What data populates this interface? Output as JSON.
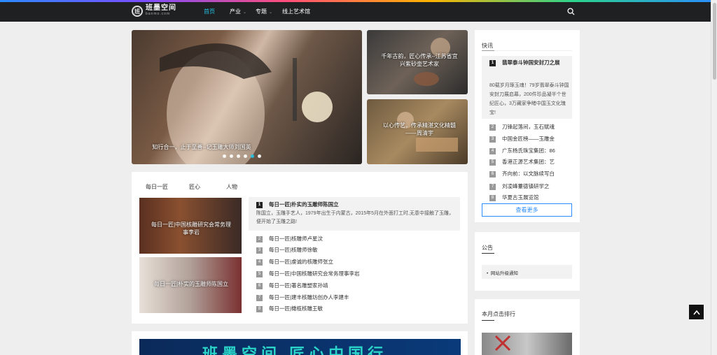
{
  "header": {
    "logo_mark": "班",
    "logo_title": "班墨空间",
    "logo_sub": "banmo.com",
    "nav": [
      "首页",
      "产业",
      "专题",
      "线上艺术馆"
    ]
  },
  "slider": {
    "main_caption": "知行合一，止于至善--记玉雕大师刘国英",
    "side_captions": [
      "千年古韵，匠心传承--江苏省宜兴紫砂壶艺术家",
      "以心传艺，传承精湛文化精髓——周清宇"
    ]
  },
  "feature": {
    "tabs": [
      "每日一匠",
      "匠心",
      "人物"
    ],
    "photo_captions": [
      "每日一匠|中国核雕研究会常务理事李岩",
      "每日一匠|朴实的玉雕师陈国立"
    ],
    "top_item": {
      "rank": "1",
      "title": "每日一匠|朴实的玉雕师陈国立",
      "desc": "陈国立，玉雕手艺人，1979年出生于内蒙古，2015年5月在外面打工时,无意中接触了玉雕，便开始了玉雕之路!"
    },
    "items": [
      {
        "rank": "2",
        "title": "每日一匠|核雕师卢星汶"
      },
      {
        "rank": "3",
        "title": "每日一匠|核雕师徐敏"
      },
      {
        "rank": "4",
        "title": "每日一匠|虔诚的核雕师张立"
      },
      {
        "rank": "5",
        "title": "每日一匠|中国核雕研究会常务理事李岩"
      },
      {
        "rank": "6",
        "title": "每日一匠|著名雕塑家孙靖"
      },
      {
        "rank": "7",
        "title": "每日一匠|建丰核雕坊创办人李建丰"
      },
      {
        "rank": "8",
        "title": "每日一匠|橄榄核雕王敏"
      }
    ]
  },
  "banner": {
    "text": "班墨空间 匠心中国行"
  },
  "news": {
    "title": "快讯",
    "top": {
      "rank": "1",
      "title": "翡翠泰斗钟国安封刀之展",
      "desc": "80载岁月琢玉魂！79岁翡翠泰斗钟国安封刀展启幕，200件珍品凝半个世纪匠心，3万藏家争睹中国玉文化瑰宝!"
    },
    "items": [
      {
        "rank": "2",
        "title": "刀锋起落间，玉石赋魂"
      },
      {
        "rank": "3",
        "title": "中国金匠榜——玉雕金"
      },
      {
        "rank": "4",
        "title": "广东杨氏珠宝集团：86"
      },
      {
        "rank": "5",
        "title": "香港正源艺术集团：艺"
      },
      {
        "rank": "6",
        "title": "齐向前：以文脉续写白"
      },
      {
        "rank": "7",
        "title": "刘凌峰薹德镇研学之"
      },
      {
        "rank": "8",
        "title": "华夏古玉展览馆"
      }
    ],
    "more": "查看更多"
  },
  "notice": {
    "title": "公告",
    "items": [
      "网站升级通知"
    ]
  },
  "monthly": {
    "title": "本月点击排行"
  },
  "colors": {
    "accent": "#24c5e6",
    "nav_bg": "#1f2022",
    "link_blue": "#2b8cff"
  }
}
